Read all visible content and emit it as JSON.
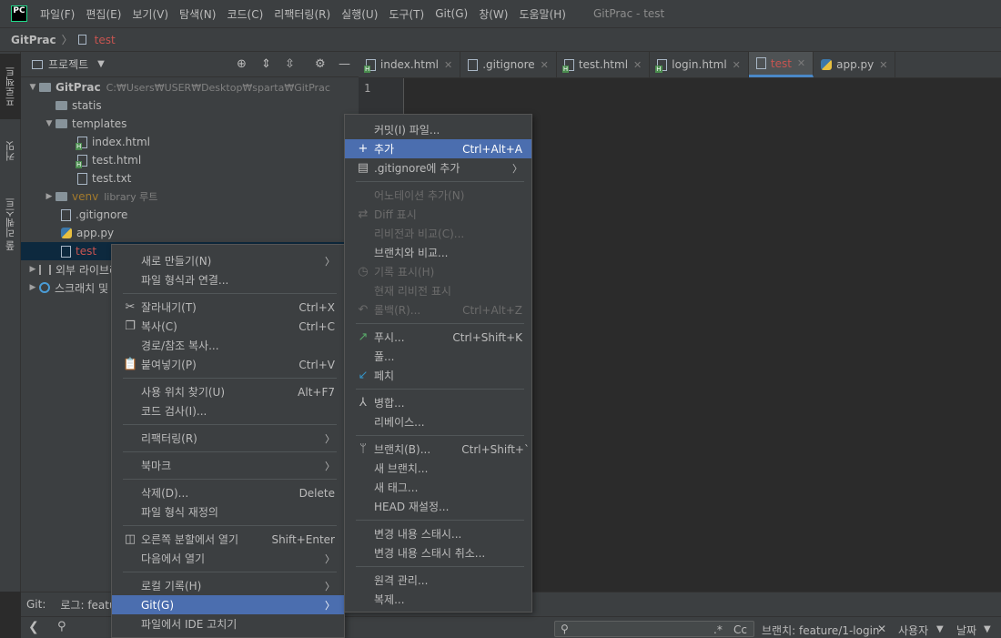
{
  "menubar": {
    "logo": "PC",
    "items": [
      "파일(F)",
      "편집(E)",
      "보기(V)",
      "탐색(N)",
      "코드(C)",
      "리팩터링(R)",
      "실행(U)",
      "도구(T)",
      "Git(G)",
      "창(W)",
      "도움말(H)"
    ],
    "window_title": "GitPrac - test"
  },
  "breadcrumb": {
    "project": "GitPrac",
    "file": "test"
  },
  "toolstrip": {
    "project_tab": "프로젝트",
    "commit_tab": "커밋",
    "pull_requests_tab": "풀 리퀘스트"
  },
  "project_panel": {
    "title": "프로젝트",
    "tree": {
      "root": "GitPrac",
      "root_path": "C:₩Users₩USER₩Desktop₩sparta₩GitPrac",
      "statis": "statis",
      "templates": "templates",
      "index_html": "index.html",
      "test_html": "test.html",
      "test_txt": "test.txt",
      "venv": "venv",
      "venv_note": "library 루트",
      "gitignore": ".gitignore",
      "app_py": "app.py",
      "test": "test",
      "external_libs": "외부 라이브러리",
      "scratches": "스크래치 및 콘솔"
    }
  },
  "tabs": [
    {
      "label": "index.html"
    },
    {
      "label": ".gitignore"
    },
    {
      "label": "test.html"
    },
    {
      "label": "login.html"
    },
    {
      "label": "test"
    },
    {
      "label": "app.py"
    }
  ],
  "editor": {
    "line_number": "1"
  },
  "git_bar": {
    "label": "Git:",
    "log_tab": "로그: featu"
  },
  "bottom_bar": {
    "regex_label": ".*",
    "case_label": "Cc",
    "branch_filter": "브랜치: feature/1-login",
    "user_filter": "사용자",
    "date_filter": "날짜"
  },
  "context_menu": {
    "new": "새로 만들기(N)",
    "associate": "파일 형식과 연결...",
    "cut": "잘라내기(T)",
    "cut_sc": "Ctrl+X",
    "copy": "복사(C)",
    "copy_sc": "Ctrl+C",
    "copy_path": "경로/참조 복사...",
    "paste": "붙여넣기(P)",
    "paste_sc": "Ctrl+V",
    "find_usages": "사용 위치 찾기(U)",
    "find_usages_sc": "Alt+F7",
    "inspect": "코드 검사(I)...",
    "refactor": "리팩터링(R)",
    "bookmarks": "북마크",
    "delete": "삭제(D)...",
    "delete_sc": "Delete",
    "override_type": "파일 형식 재정의",
    "open_right": "오른쪽 분할에서 열기",
    "open_right_sc": "Shift+Enter",
    "open_in": "다음에서 열기",
    "local_history": "로컬 기록(H)",
    "git": "Git(G)",
    "repair_ide": "파일에서 IDE 고치기"
  },
  "git_menu": {
    "commit_file": "커밋(I) 파일...",
    "add": "추가",
    "add_sc": "Ctrl+Alt+A",
    "gitignore_add": ".gitignore에 추가",
    "annotate": "어노테이션 추가(N)",
    "diff": "Diff 표시",
    "compare_revision": "리비전과 비교(C)...",
    "compare_branch": "브랜치와 비교...",
    "show_history": "기록 표시(H)",
    "show_current_revision": "현재 리비전 표시",
    "rollback": "롤백(R)...",
    "rollback_sc": "Ctrl+Alt+Z",
    "push": "푸시...",
    "push_sc": "Ctrl+Shift+K",
    "pull": "풀...",
    "fetch": "페치",
    "merge": "병합...",
    "rebase": "리베이스...",
    "branches": "브랜치(B)...",
    "branches_sc": "Ctrl+Shift+`",
    "new_branch": "새 브랜치...",
    "new_tag": "새 태그...",
    "reset_head": "HEAD 재설정...",
    "stash": "변경 내용 스태시...",
    "unstash": "변경 내용 스태시 취소...",
    "remotes": "원격 관리...",
    "clone": "복제..."
  }
}
